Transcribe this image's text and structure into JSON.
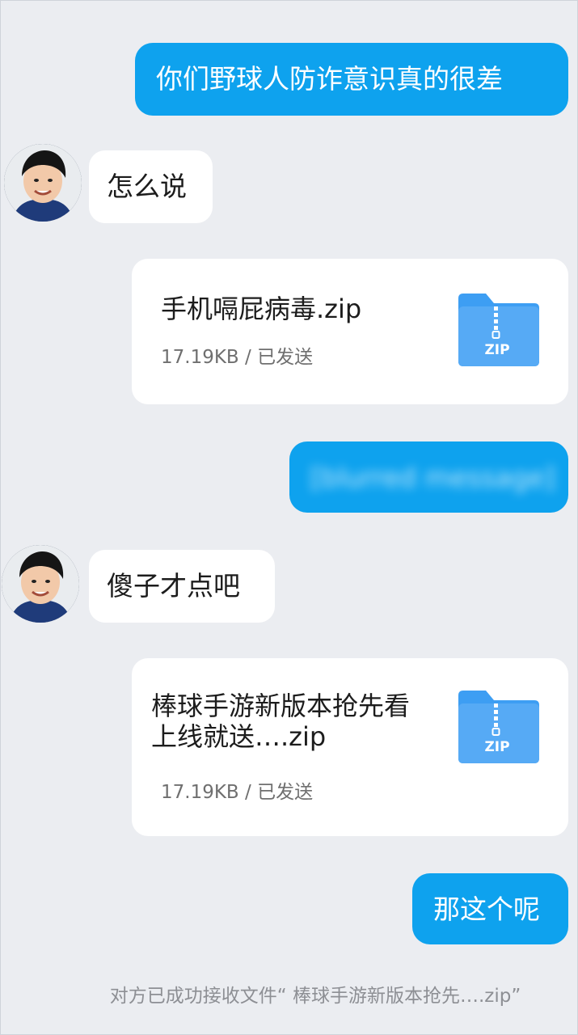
{
  "messages": {
    "m1": {
      "text": "你们野球人防诈意识真的很差"
    },
    "m2": {
      "text": "怎么说"
    },
    "file1": {
      "name": "手机嗝屁病毒.zip",
      "meta": "17.19KB / 已发送",
      "icon_label": "ZIP"
    },
    "m4": {
      "text": "[blurred message]"
    },
    "m5": {
      "text": "傻子才点吧"
    },
    "file2": {
      "name": "棒球手游新版本抢先看\n上线就送….zip",
      "meta": "17.19KB / 已发送",
      "icon_label": "ZIP"
    },
    "m7": {
      "text": "那这个呢"
    }
  },
  "system_note": "对方已成功接收文件“ 棒球手游新版本抢先….zip”",
  "colors": {
    "background": "#ebedf1",
    "outgoing_bubble": "#0ea2ee",
    "incoming_bubble": "#ffffff",
    "zip_icon": "#3d9ef3"
  },
  "icons": {
    "avatar": "user-avatar-photo",
    "file": "zip-folder-icon"
  }
}
